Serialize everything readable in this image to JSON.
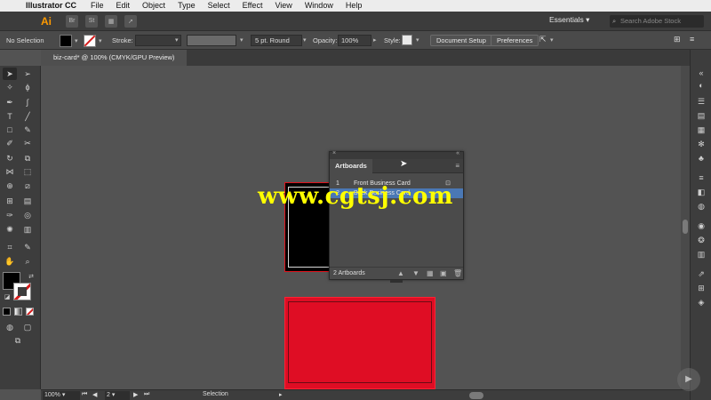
{
  "menubar": {
    "app_name": "Illustrator CC",
    "items": [
      "File",
      "Edit",
      "Object",
      "Type",
      "Select",
      "Effect",
      "View",
      "Window",
      "Help"
    ]
  },
  "appbar": {
    "logo": "Ai",
    "bridge_label": "Br",
    "stock_label": "St",
    "workspace": "Essentials",
    "search_placeholder": "Search Adobe Stock"
  },
  "controlbar": {
    "selection_label": "No Selection",
    "stroke_label": "Stroke:",
    "brush_label": "5 pt. Round",
    "opacity_label": "Opacity:",
    "opacity_value": "100%",
    "style_label": "Style:",
    "document_setup": "Document Setup",
    "preferences": "Preferences"
  },
  "document": {
    "tab_title": "biz-card* @ 100% (CMYK/GPU Preview)"
  },
  "artboards_panel": {
    "title": "Artboards",
    "rows": [
      {
        "num": "1",
        "name": "Front Business Card"
      },
      {
        "num": "2",
        "name": "Back Business Card"
      }
    ],
    "footer_count": "2 Artboards"
  },
  "statusbar": {
    "zoom": "100%",
    "artboard_num": "2",
    "tool_name": "Selection"
  },
  "watermark": "www.cgtsj.com",
  "colors": {
    "artboard_red": "#df0d24",
    "selected_row": "#4a78b5",
    "ai_orange": "#ff9a00",
    "watermark_yellow": "#ffff00"
  },
  "icons": {
    "cursor": "arrow-pointer-icon"
  }
}
